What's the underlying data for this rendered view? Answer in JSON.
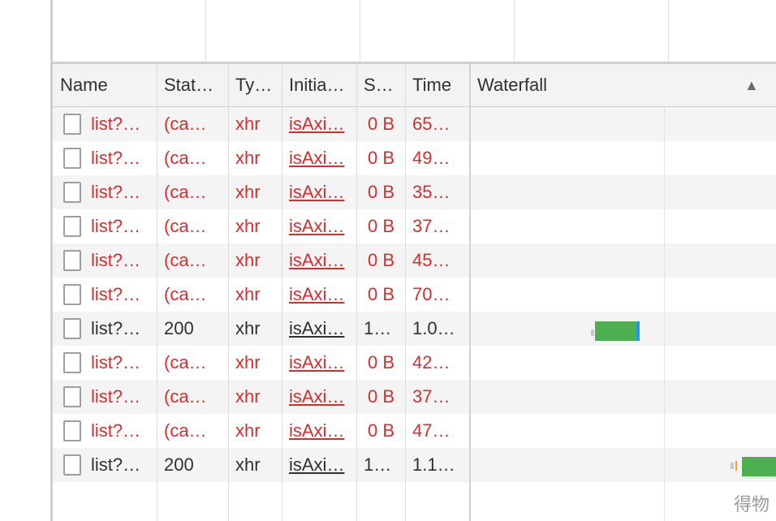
{
  "columns": {
    "name": "Name",
    "status": "Stat…",
    "type": "Ty…",
    "initiator": "Initia…",
    "size": "S…",
    "time": "Time",
    "waterfall": "Waterfall"
  },
  "sort_icon": "▲",
  "colors": {
    "error_text": "#d32f2f",
    "normal_text": "#303030",
    "waterfall_receive": "#4caf50",
    "waterfall_wait": "#2196f3"
  },
  "rows": [
    {
      "name": "list?…",
      "status": "(ca…",
      "type": "xhr",
      "initiator": "isAxi…",
      "size": "0 B",
      "time": "65…",
      "error": true
    },
    {
      "name": "list?…",
      "status": "(ca…",
      "type": "xhr",
      "initiator": "isAxi…",
      "size": "0 B",
      "time": "49…",
      "error": true
    },
    {
      "name": "list?…",
      "status": "(ca…",
      "type": "xhr",
      "initiator": "isAxi…",
      "size": "0 B",
      "time": "35…",
      "error": true
    },
    {
      "name": "list?…",
      "status": "(ca…",
      "type": "xhr",
      "initiator": "isAxi…",
      "size": "0 B",
      "time": "37…",
      "error": true
    },
    {
      "name": "list?…",
      "status": "(ca…",
      "type": "xhr",
      "initiator": "isAxi…",
      "size": "0 B",
      "time": "45…",
      "error": true
    },
    {
      "name": "list?…",
      "status": "(ca…",
      "type": "xhr",
      "initiator": "isAxi…",
      "size": "0 B",
      "time": "70…",
      "error": true
    },
    {
      "name": "list?…",
      "status": "200",
      "type": "xhr",
      "initiator": "isAxi…",
      "size": "1…",
      "time": "1.0…",
      "error": false
    },
    {
      "name": "list?…",
      "status": "(ca…",
      "type": "xhr",
      "initiator": "isAxi…",
      "size": "0 B",
      "time": "42…",
      "error": true
    },
    {
      "name": "list?…",
      "status": "(ca…",
      "type": "xhr",
      "initiator": "isAxi…",
      "size": "0 B",
      "time": "37…",
      "error": true
    },
    {
      "name": "list?…",
      "status": "(ca…",
      "type": "xhr",
      "initiator": "isAxi…",
      "size": "0 B",
      "time": "47…",
      "error": true
    },
    {
      "name": "list?…",
      "status": "200",
      "type": "xhr",
      "initiator": "isAxi…",
      "size": "1…",
      "time": "1.1…",
      "error": false
    }
  ],
  "watermark": "得物"
}
